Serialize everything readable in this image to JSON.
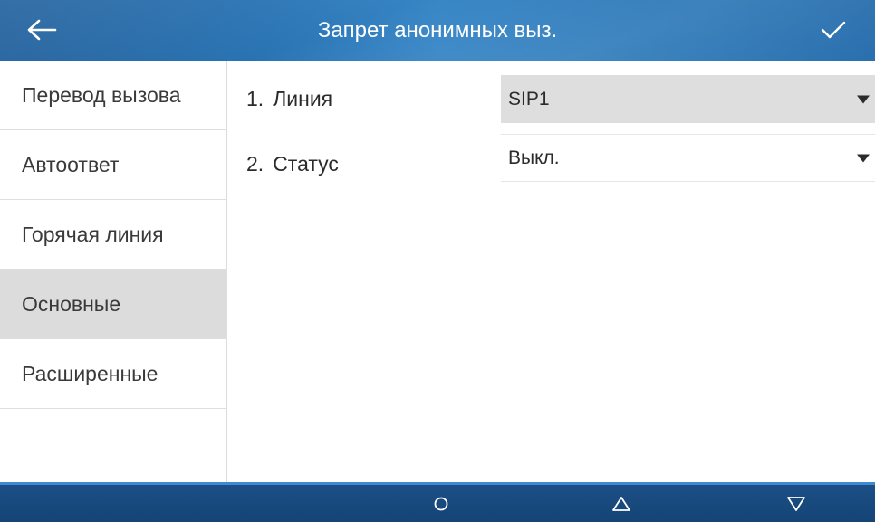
{
  "header": {
    "title": "Запрет анонимных выз.",
    "back_icon": "arrow-left-icon",
    "confirm_icon": "checkmark-icon"
  },
  "sidebar": {
    "items": [
      {
        "label": "Перевод вызова",
        "active": false
      },
      {
        "label": "Автоответ",
        "active": false
      },
      {
        "label": "Горячая линия",
        "active": false
      },
      {
        "label": "Основные",
        "active": true
      },
      {
        "label": "Расширенные",
        "active": false
      }
    ]
  },
  "form": {
    "rows": [
      {
        "number": "1.",
        "label": "Линия",
        "value": "SIP1"
      },
      {
        "number": "2.",
        "label": "Статус",
        "value": "Выкл."
      }
    ]
  },
  "navbar": {
    "buttons": [
      "home-circle-icon",
      "up-triangle-icon",
      "down-triangle-icon"
    ]
  },
  "colors": {
    "header": "#2a74b4",
    "navbar": "#1b4f86",
    "active_item": "#dcdcdc"
  }
}
